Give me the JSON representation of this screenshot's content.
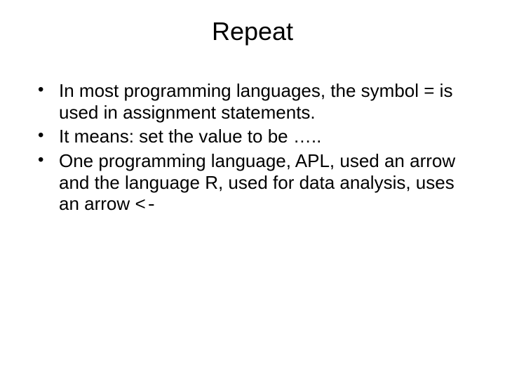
{
  "title": "Repeat",
  "bullets": [
    "In most programming languages, the symbol = is used in assignment statements.",
    "It means: set the value to be …..",
    "One programming language, APL, used an arrow and the language R, used for data analysis, uses an arrow  "
  ],
  "arrow_symbol": "<-"
}
